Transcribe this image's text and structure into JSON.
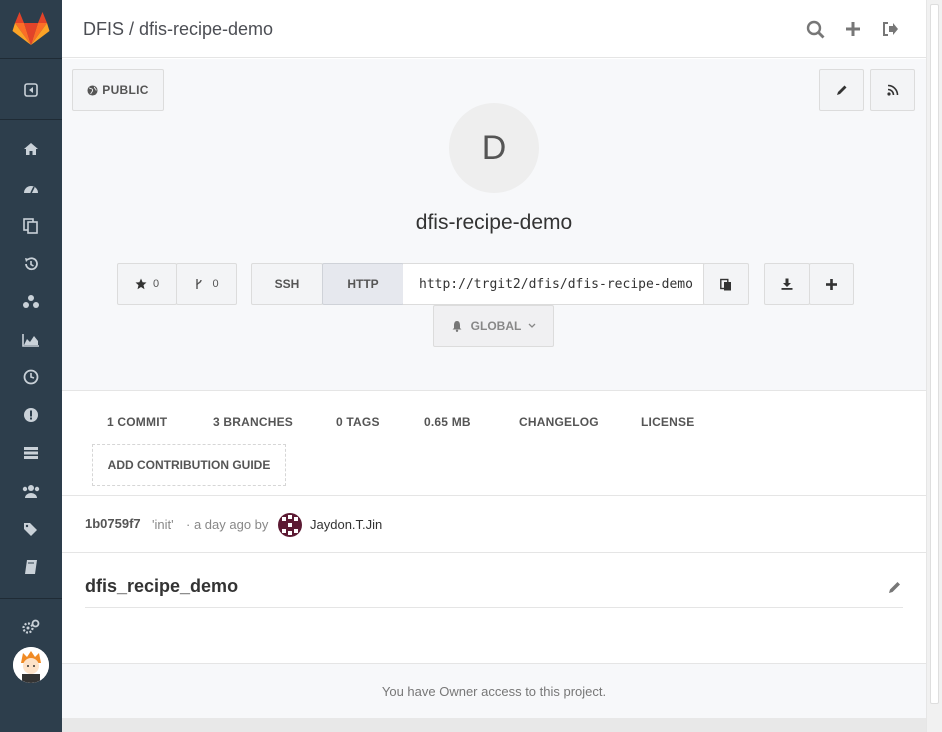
{
  "header": {
    "breadcrumb": "DFIS / dfis-recipe-demo"
  },
  "sidebar": {
    "icons": [
      "collapse-icon",
      "home-icon",
      "dashboard-icon",
      "files-icon",
      "history-icon",
      "network-icon",
      "graph-icon",
      "milestones-icon",
      "issues-icon",
      "merge-requests-icon",
      "members-icon",
      "labels-icon",
      "wiki-icon",
      "settings-icon"
    ]
  },
  "project": {
    "visibility": "PUBLIC",
    "initial": "D",
    "name": "dfis-recipe-demo",
    "star_count": "0",
    "fork_count": "0",
    "protocol_ssh": "SSH",
    "protocol_http": "HTTP",
    "clone_url": "http://trgit2/dfis/dfis-recipe-demo",
    "notification_level": "GLOBAL"
  },
  "stats": {
    "commits": "1 COMMIT",
    "branches": "3 BRANCHES",
    "tags": "0 TAGS",
    "size": "0.65 MB",
    "changelog": "CHANGELOG",
    "license": "LICENSE",
    "contribution": "ADD CONTRIBUTION GUIDE"
  },
  "commit": {
    "sha": "1b0759f7",
    "message": "'init'",
    "meta": "· a day ago by",
    "author": "Jaydon.T.Jin"
  },
  "readme": {
    "title": "dfis_recipe_demo"
  },
  "footer": {
    "access_text": "You have Owner access to this project."
  },
  "colors": {
    "sidebar_bg": "#2d3e4c",
    "gitlab_orange": "#e24329",
    "page_band": "#f7f8fa"
  }
}
